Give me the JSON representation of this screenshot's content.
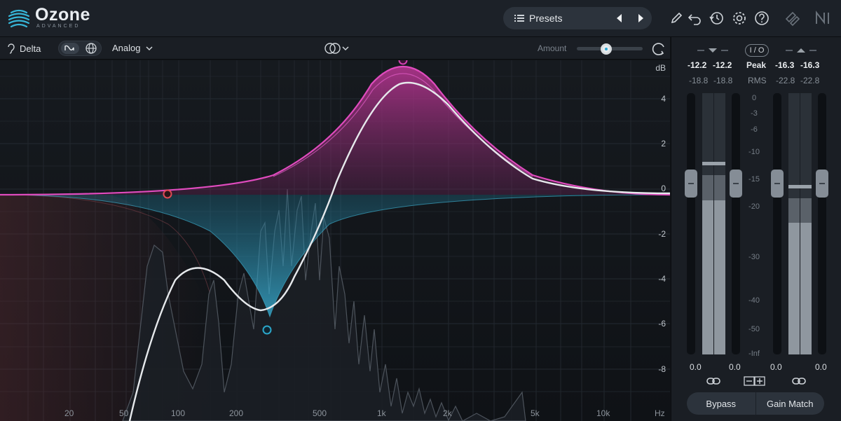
{
  "header": {
    "brand": "Ozone",
    "brand_sub": "ADVANCED",
    "presets_label": "Presets",
    "icons": [
      "pencil-icon",
      "undo-icon",
      "history-icon",
      "gear-icon",
      "help-icon",
      "ni-link-icon",
      "ni-logo-icon"
    ]
  },
  "toolbar": {
    "delta_label": "Delta",
    "filter_mode": "Analog",
    "amount_label": "Amount",
    "amount_value": 0.45
  },
  "eq": {
    "db_unit": "dB",
    "db_ticks": [
      "4",
      "2",
      "0",
      "-2",
      "-4",
      "-6",
      "-8"
    ],
    "hz_unit": "Hz",
    "hz_ticks": [
      "20",
      "50",
      "100",
      "200",
      "500",
      "1k",
      "2k",
      "5k",
      "10k"
    ]
  },
  "meters": {
    "in_peak_l": "-12.2",
    "in_peak_r": "-12.2",
    "in_rms_l": "-18.8",
    "in_rms_r": "-18.8",
    "out_peak_l": "-16.3",
    "out_peak_r": "-16.3",
    "out_rms_l": "-22.8",
    "out_rms_r": "-22.8",
    "peak_label": "Peak",
    "rms_label": "RMS",
    "io_label": "I / O",
    "scale": [
      "0",
      "-3",
      "-6",
      "-10",
      "-15",
      "-20",
      "-30",
      "-40",
      "-50",
      "-Inf"
    ],
    "gain_in_l": "0.0",
    "gain_in_r": "0.0",
    "gain_out_l": "0.0",
    "gain_out_r": "0.0",
    "bypass_label": "Bypass",
    "gain_match_label": "Gain Match"
  },
  "colors": {
    "accent_pink": "#d13fb0",
    "accent_cyan": "#2ba6c9",
    "node_red": "#e04a55"
  }
}
